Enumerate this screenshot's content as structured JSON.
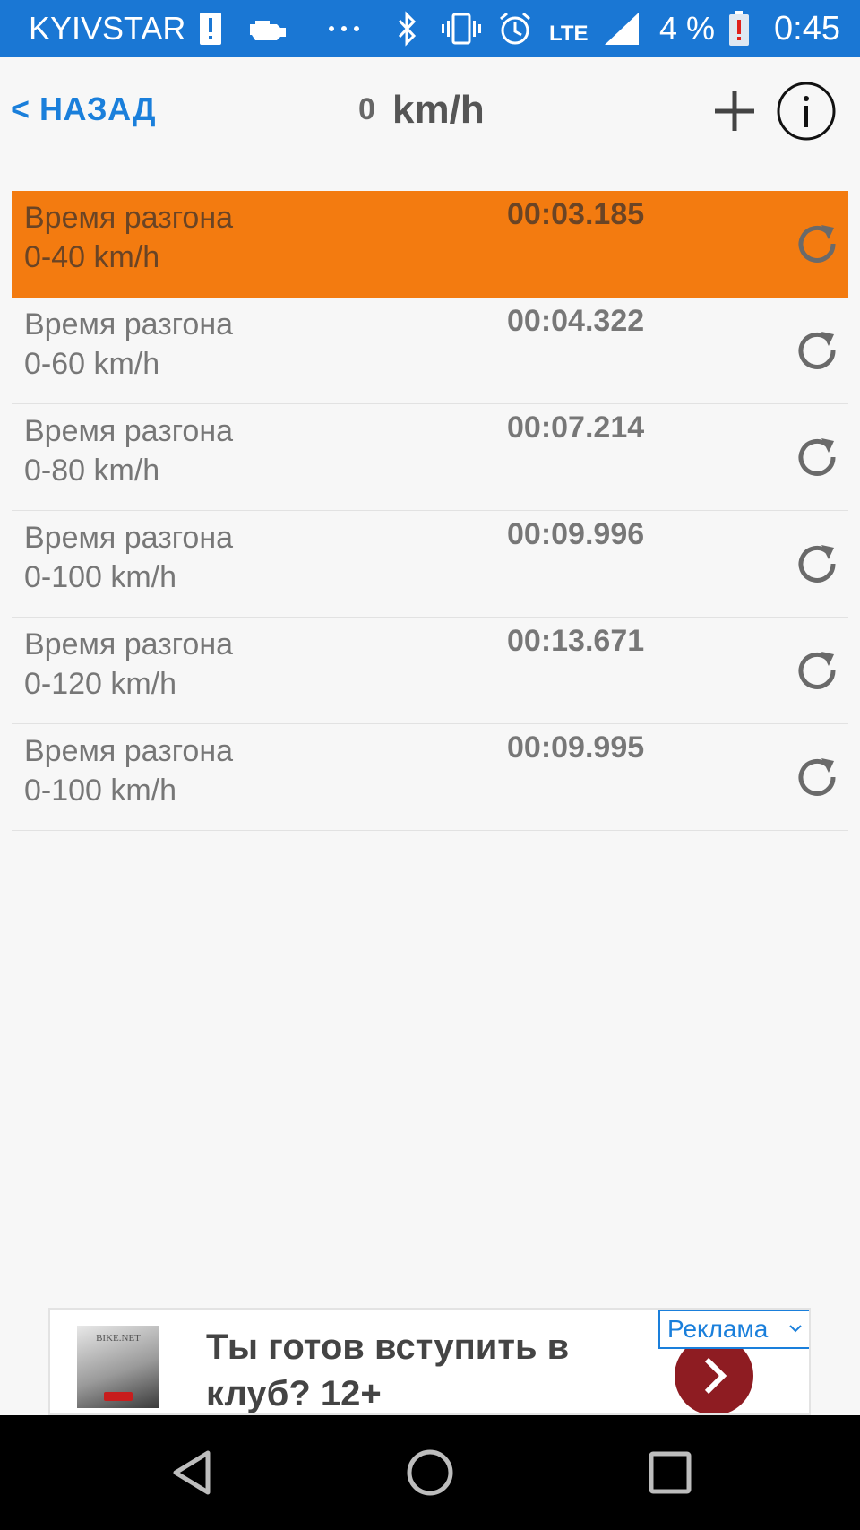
{
  "status_bar": {
    "carrier": "KYIVSTAR",
    "network": "LTE",
    "battery_percent": "4 %",
    "time": "0:45",
    "icons": [
      "alert-icon",
      "engine-icon",
      "more-icon",
      "bluetooth-icon",
      "vibrate-icon",
      "alarm-icon",
      "signal-icon",
      "battery-low-icon"
    ]
  },
  "header": {
    "back_label": "< НАЗАД",
    "speed_value": "0",
    "speed_unit": "km/h",
    "add_icon": "plus-icon",
    "info_icon": "info-icon"
  },
  "results": [
    {
      "title": "Время разгона",
      "range": "0-40 km/h",
      "time": "00:03.185",
      "active": true
    },
    {
      "title": "Время разгона",
      "range": "0-60 km/h",
      "time": "00:04.322",
      "active": false
    },
    {
      "title": "Время разгона",
      "range": "0-80 km/h",
      "time": "00:07.214",
      "active": false
    },
    {
      "title": "Время разгона",
      "range": "0-100 km/h",
      "time": "00:09.996",
      "active": false
    },
    {
      "title": "Время разгона",
      "range": "0-120 km/h",
      "time": "00:13.671",
      "active": false
    },
    {
      "title": "Время разгона",
      "range": "0-100 km/h",
      "time": "00:09.995",
      "active": false
    }
  ],
  "ad": {
    "thumb_text": "BIKE.NET",
    "headline": "Ты готов вступить в клуб? 12+",
    "badge": "Реклама"
  },
  "colors": {
    "status_bar": "#1a77d4",
    "accent": "#1a7fdb",
    "active_row": "#f37b10",
    "ad_button": "#8e1c22"
  }
}
